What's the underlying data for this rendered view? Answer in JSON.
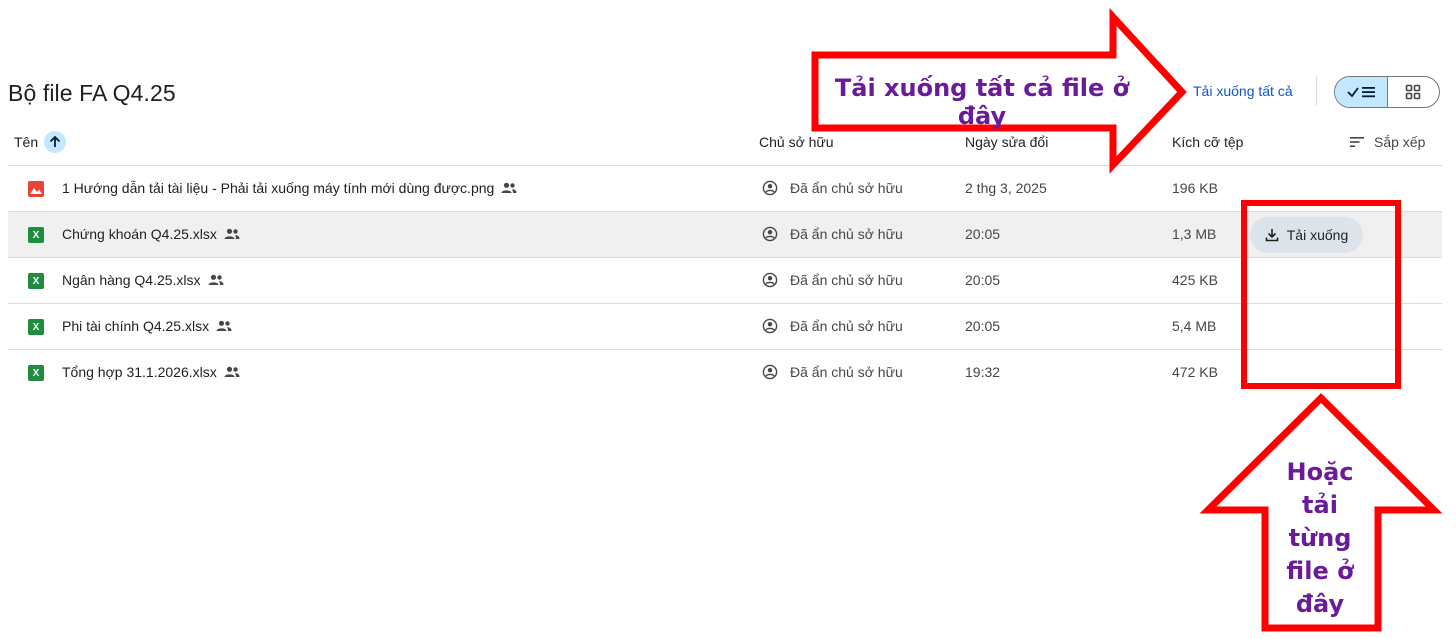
{
  "folder": {
    "title": "Bộ file FA Q4.25"
  },
  "toolbar": {
    "download_all": "Tải xuống tất cả"
  },
  "view_toggle": {
    "list_icon": "check-list-icon",
    "grid_icon": "grid-icon",
    "active": "list"
  },
  "columns": {
    "name": "Tên",
    "owner": "Chủ sở hữu",
    "modified": "Ngày sửa đổi",
    "size": "Kích cỡ tệp",
    "sort": "Sắp xếp"
  },
  "files": [
    {
      "name": "1 Hướng dẫn tải tài liệu - Phải tải xuống máy tính mới dùng được.png",
      "type": "png",
      "owner": "Đã ẩn chủ sở hữu",
      "modified": "2 thg 3, 2025",
      "size": "196 KB"
    },
    {
      "name": "Chứng khoán Q4.25.xlsx",
      "type": "xlsx",
      "owner": "Đã ẩn chủ sở hữu",
      "modified": "20:05",
      "size": "1,3 MB"
    },
    {
      "name": "Ngân hàng Q4.25.xlsx",
      "type": "xlsx",
      "owner": "Đã ẩn chủ sở hữu",
      "modified": "20:05",
      "size": "425 KB"
    },
    {
      "name": "Phi tài chính Q4.25.xlsx",
      "type": "xlsx",
      "owner": "Đã ẩn chủ sở hữu",
      "modified": "20:05",
      "size": "5,4 MB"
    },
    {
      "name": "Tổng hợp 31.1.2026.xlsx",
      "type": "xlsx",
      "owner": "Đã ẩn chủ sở hữu",
      "modified": "19:32",
      "size": "472 KB"
    }
  ],
  "row_action": {
    "download": "Tải xuống"
  },
  "file_icon_letter": "X",
  "annotations": {
    "top": "Tải xuống tất cả file ở đây",
    "bottom": [
      "Hoặc",
      "tải",
      "từng",
      "file ở",
      "đây"
    ],
    "color_arrow": "#ff0000",
    "color_text": "#6a1b9a"
  }
}
